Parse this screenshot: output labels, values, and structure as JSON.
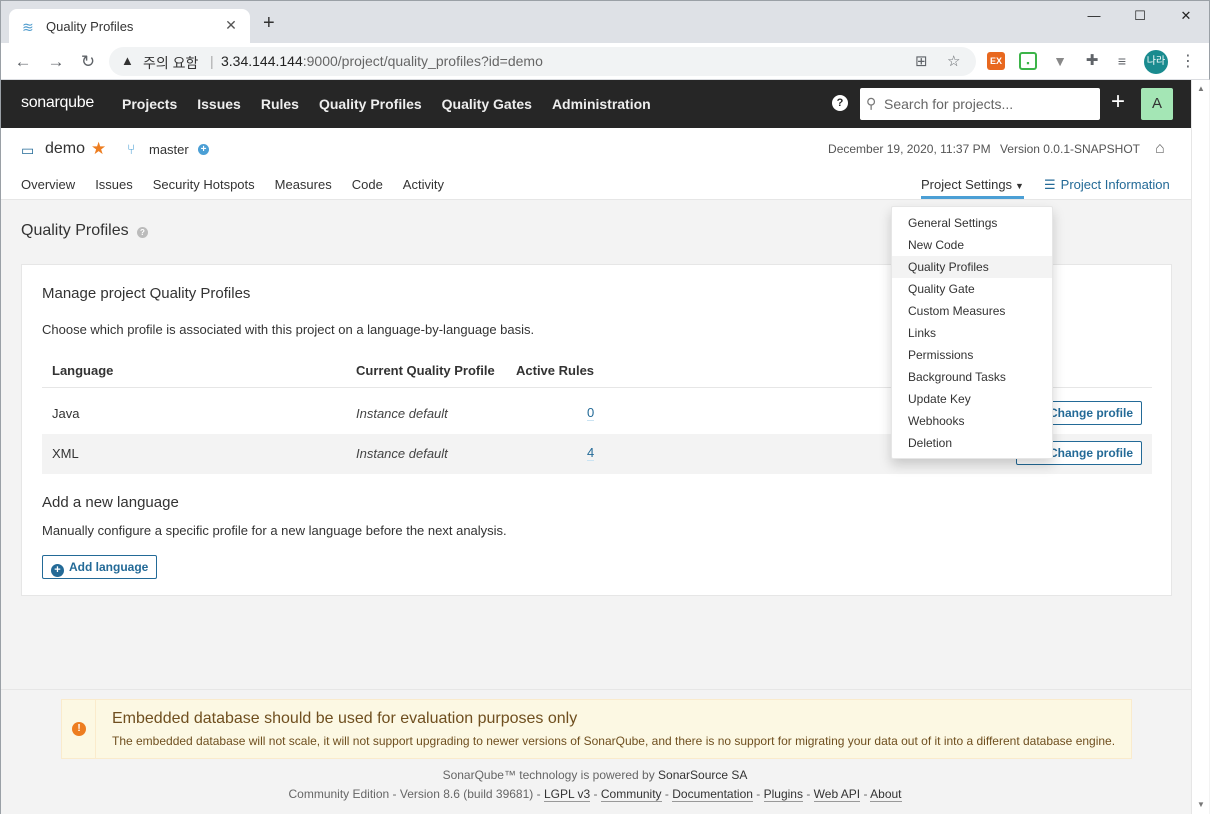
{
  "browser": {
    "tab_title": "Quality Profiles",
    "omnibox_security_label": "주의 요함",
    "url_host": "3.34.144.144",
    "url_rest": ":9000/project/quality_profiles?id=demo",
    "profile_badge": "나라"
  },
  "sq_nav": {
    "logo": "sonarqube",
    "menu": [
      "Projects",
      "Issues",
      "Rules",
      "Quality Profiles",
      "Quality Gates",
      "Administration"
    ],
    "search_placeholder": "Search for projects...",
    "avatar_letter": "A"
  },
  "project": {
    "name": "demo",
    "branch": "master",
    "date": "December 19, 2020, 11:37 PM",
    "version": "Version 0.0.1-SNAPSHOT",
    "tabs": [
      "Overview",
      "Issues",
      "Security Hotspots",
      "Measures",
      "Code",
      "Activity"
    ],
    "settings_label": "Project Settings",
    "info_label": "Project Information"
  },
  "settings_menu": {
    "items": [
      "General Settings",
      "New Code",
      "Quality Profiles",
      "Quality Gate",
      "Custom Measures",
      "Links",
      "Permissions",
      "Background Tasks",
      "Update Key",
      "Webhooks",
      "Deletion"
    ],
    "active": "Quality Profiles"
  },
  "page": {
    "title": "Quality Profiles",
    "card_title": "Manage project Quality Profiles",
    "card_desc": "Choose which profile is associated with this project on a language-by-language basis.",
    "columns": [
      "Language",
      "Current Quality Profile",
      "Active Rules"
    ],
    "rows": [
      {
        "language": "Java",
        "profile": "Instance default",
        "active_rules": "0",
        "action": "Change profile"
      },
      {
        "language": "XML",
        "profile": "Instance default",
        "active_rules": "4",
        "action": "Change profile"
      }
    ],
    "add_title": "Add a new language",
    "add_desc": "Manually configure a specific profile for a new language before the next analysis.",
    "add_button": "Add language"
  },
  "footer": {
    "warning_title": "Embedded database should be used for evaluation purposes only",
    "warning_text": "The embedded database will not scale, it will not support upgrading to newer versions of SonarQube, and there is no support for migrating your data out of it into a different database engine.",
    "powered_prefix": "SonarQube™ technology is powered by ",
    "powered_link": "SonarSource SA",
    "edition": "Community Edition - Version 8.6 (build 39681) - ",
    "links": [
      "LGPL v3",
      "Community",
      "Documentation",
      "Plugins",
      "Web API",
      "About"
    ]
  },
  "colors": {
    "nav_bg": "#262626",
    "accent_blue": "#236a97",
    "star_orange": "#ed7d20",
    "avatar_green": "#a4e6b5",
    "warning_bg": "#fcf8e3"
  }
}
